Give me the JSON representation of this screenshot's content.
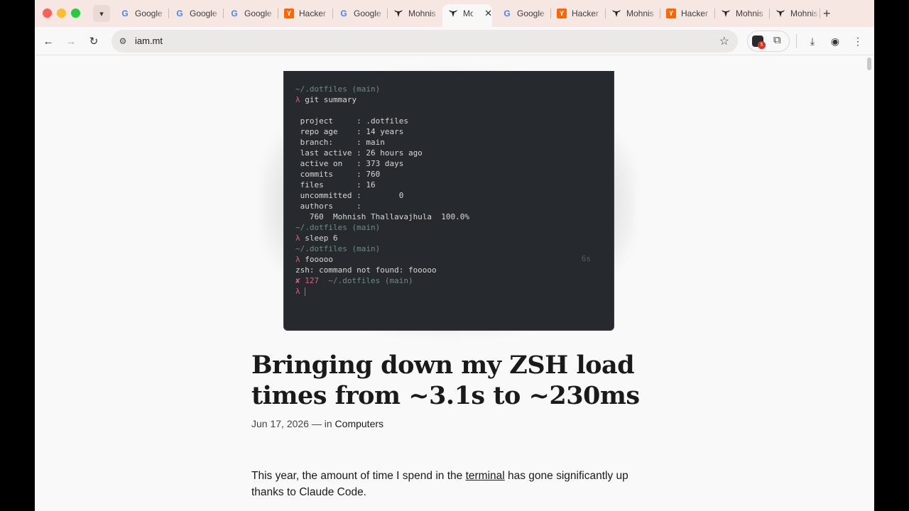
{
  "browser": {
    "tabs": [
      {
        "favicon": "google-g-icon",
        "title": "Google"
      },
      {
        "favicon": "google-g-icon",
        "title": "Google"
      },
      {
        "favicon": "google-g-icon",
        "title": "Google"
      },
      {
        "favicon": "hacker-news-y-icon",
        "title": "Hacker"
      },
      {
        "favicon": "google-g-icon",
        "title": "Google"
      },
      {
        "favicon": "bull-skull-icon",
        "title": "Mohnis"
      },
      {
        "favicon": "bull-skull-icon",
        "title": "Mo",
        "active": true
      },
      {
        "favicon": "google-g-icon",
        "title": "Google"
      },
      {
        "favicon": "hacker-news-y-icon",
        "title": "Hacker"
      },
      {
        "favicon": "bull-skull-icon",
        "title": "Mohnis"
      },
      {
        "favicon": "hacker-news-y-icon",
        "title": "Hacker"
      },
      {
        "favicon": "bull-skull-icon",
        "title": "Mohnis"
      },
      {
        "favicon": "bull-skull-icon",
        "title": "Mohnis"
      }
    ],
    "url": "iam.mt",
    "extension_badge": "5"
  },
  "terminal": {
    "prompt_path": "~/.dotfiles (main)",
    "lambda": "λ",
    "cmd1": "git summary",
    "summary": [
      " project     : .dotfiles",
      " repo age    : 14 years",
      " branch:     : main",
      " last active : 26 hours ago",
      " active on   : 373 days",
      " commits     : 760",
      " files       : 16",
      " uncommitted :        0",
      " authors     :",
      "   760  Mohnish Thallavajhula  100.0%"
    ],
    "cmd2": "sleep 6",
    "cmd3": "fooooo",
    "duration": "6s",
    "error_line": "zsh: command not found: fooooo",
    "error_mark": "✘ 127"
  },
  "article": {
    "title": "Bringing down my ZSH load times from ~3.1s to ~230ms",
    "date": "Jun 17, 2026",
    "in_text": "— in",
    "category": "Computers",
    "body_pre": "This year, the amount of time I spend in the ",
    "body_link": "terminal",
    "body_post": " has gone significantly up thanks to Claude Code."
  }
}
